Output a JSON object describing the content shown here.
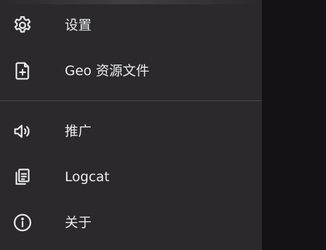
{
  "drawer": {
    "items": [
      {
        "label": "设置",
        "icon": "gear-icon"
      },
      {
        "label": "Geo 资源文件",
        "icon": "file-add-icon"
      },
      {
        "label": "推广",
        "icon": "megaphone-icon"
      },
      {
        "label": "Logcat",
        "icon": "logcat-icon"
      },
      {
        "label": "关于",
        "icon": "info-icon"
      }
    ]
  },
  "colors": {
    "drawer_background": "#2b292c",
    "scrim": "#141214",
    "text": "#ededed",
    "icon": "#e6e6e6",
    "divider": "#4a474c"
  }
}
